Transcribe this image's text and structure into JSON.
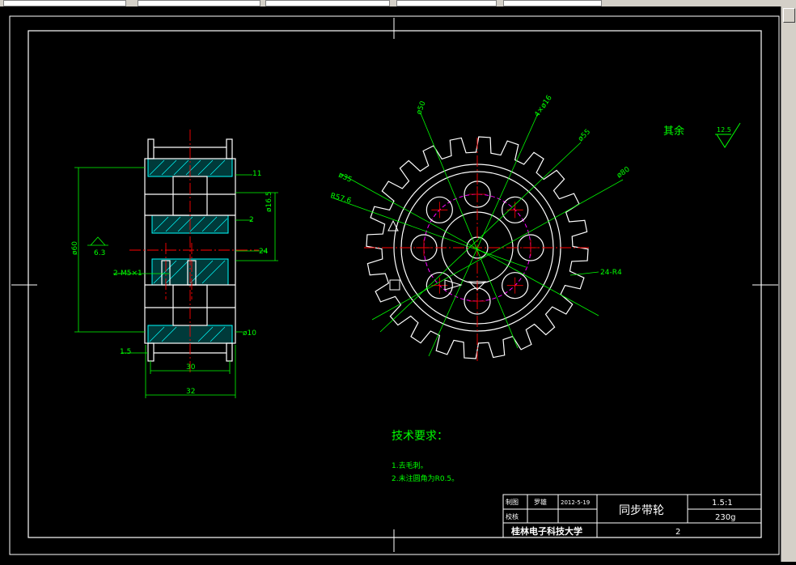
{
  "drawing": {
    "remark_label": "其余",
    "roughness_general": "12.5",
    "roughness_bore": "6.3",
    "tech": {
      "title": "技术要求：",
      "items": [
        "1.去毛刺。",
        "2.未注圆角为R0.5。"
      ]
    },
    "dims": {
      "d11": "11",
      "d2": "2",
      "d24": "24",
      "d16": "ø16.5",
      "d30": "30",
      "d32": "32",
      "d15": "1.5",
      "dphi10": "ø10",
      "thread": "2-M5×1",
      "height": "ø60",
      "ang1": "ø50",
      "ang2": "4×ø16",
      "ang3": "ø55",
      "ang4": "ø80",
      "ang5": "ø35",
      "ang6": "R57.6",
      "ang7": "ø85",
      "teeth": "24-R4"
    }
  },
  "title_block": {
    "drawn_label": "制图",
    "drawn_name": "罗雄",
    "drawn_date": "2012-5-19",
    "check_label": "校核",
    "part_name": "同步带轮",
    "scale": "1.5:1",
    "weight": "230g",
    "school": "桂林电子科技大学",
    "sheet": "2"
  },
  "colors": {
    "background": "#000000",
    "outline": "#ffffff",
    "dimension": "#00ff00",
    "centerline": "#ff0000",
    "hatch": "#00ffff",
    "hidden": "#ff00ff"
  }
}
